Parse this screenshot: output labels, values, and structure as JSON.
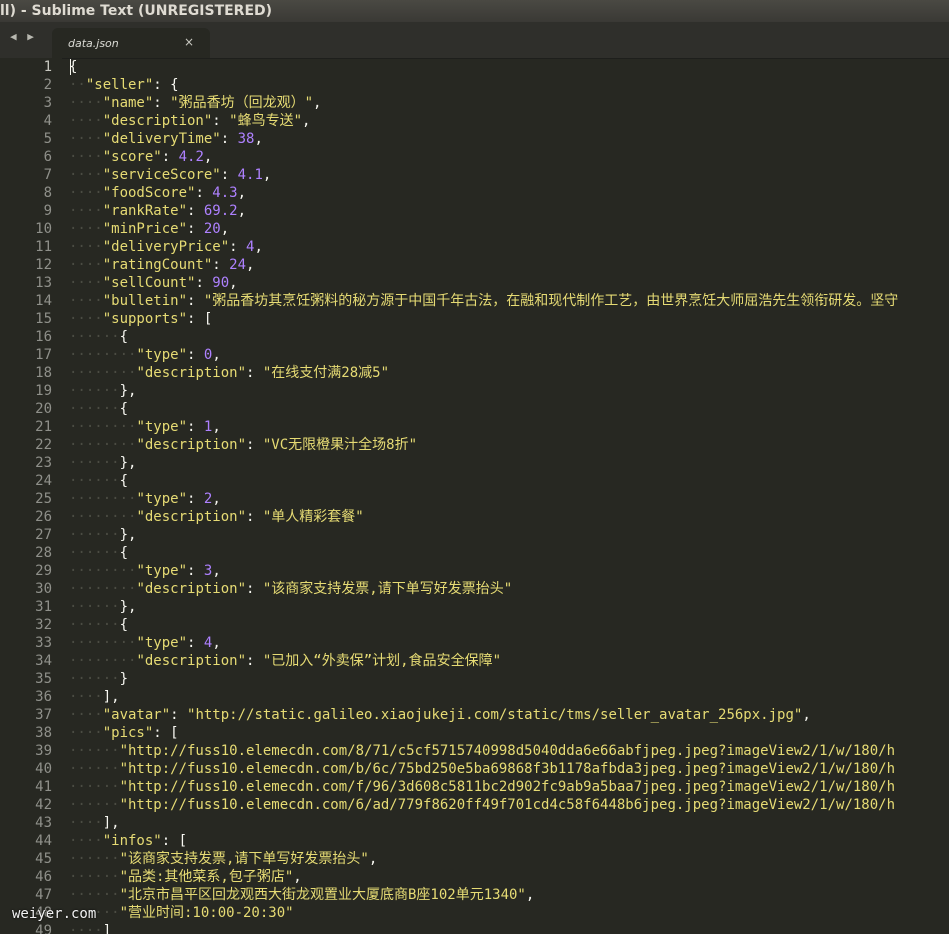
{
  "window": {
    "title": "ll) - Sublime Text (UNREGISTERED)"
  },
  "tabs": {
    "nav_label": "◀ ▶",
    "active": {
      "label": "data.json",
      "close_glyph": "×"
    }
  },
  "editor": {
    "current_line": 1,
    "lines": [
      [
        [
          "p",
          "{"
        ]
      ],
      [
        [
          "ws",
          "··"
        ],
        [
          "s",
          "\"seller\""
        ],
        [
          "p",
          ": {"
        ]
      ],
      [
        [
          "ws",
          "····"
        ],
        [
          "s",
          "\"name\""
        ],
        [
          "p",
          ": "
        ],
        [
          "s",
          "\"粥品香坊（回龙观）\""
        ],
        [
          "p",
          ","
        ]
      ],
      [
        [
          "ws",
          "····"
        ],
        [
          "s",
          "\"description\""
        ],
        [
          "p",
          ": "
        ],
        [
          "s",
          "\"蜂鸟专送\""
        ],
        [
          "p",
          ","
        ]
      ],
      [
        [
          "ws",
          "····"
        ],
        [
          "s",
          "\"deliveryTime\""
        ],
        [
          "p",
          ": "
        ],
        [
          "n",
          "38"
        ],
        [
          "p",
          ","
        ]
      ],
      [
        [
          "ws",
          "····"
        ],
        [
          "s",
          "\"score\""
        ],
        [
          "p",
          ": "
        ],
        [
          "n",
          "4.2"
        ],
        [
          "p",
          ","
        ]
      ],
      [
        [
          "ws",
          "····"
        ],
        [
          "s",
          "\"serviceScore\""
        ],
        [
          "p",
          ": "
        ],
        [
          "n",
          "4.1"
        ],
        [
          "p",
          ","
        ]
      ],
      [
        [
          "ws",
          "····"
        ],
        [
          "s",
          "\"foodScore\""
        ],
        [
          "p",
          ": "
        ],
        [
          "n",
          "4.3"
        ],
        [
          "p",
          ","
        ]
      ],
      [
        [
          "ws",
          "····"
        ],
        [
          "s",
          "\"rankRate\""
        ],
        [
          "p",
          ": "
        ],
        [
          "n",
          "69.2"
        ],
        [
          "p",
          ","
        ]
      ],
      [
        [
          "ws",
          "····"
        ],
        [
          "s",
          "\"minPrice\""
        ],
        [
          "p",
          ": "
        ],
        [
          "n",
          "20"
        ],
        [
          "p",
          ","
        ]
      ],
      [
        [
          "ws",
          "····"
        ],
        [
          "s",
          "\"deliveryPrice\""
        ],
        [
          "p",
          ": "
        ],
        [
          "n",
          "4"
        ],
        [
          "p",
          ","
        ]
      ],
      [
        [
          "ws",
          "····"
        ],
        [
          "s",
          "\"ratingCount\""
        ],
        [
          "p",
          ": "
        ],
        [
          "n",
          "24"
        ],
        [
          "p",
          ","
        ]
      ],
      [
        [
          "ws",
          "····"
        ],
        [
          "s",
          "\"sellCount\""
        ],
        [
          "p",
          ": "
        ],
        [
          "n",
          "90"
        ],
        [
          "p",
          ","
        ]
      ],
      [
        [
          "ws",
          "····"
        ],
        [
          "s",
          "\"bulletin\""
        ],
        [
          "p",
          ": "
        ],
        [
          "s",
          "\"粥品香坊其烹饪粥料的秘方源于中国千年古法，在融和现代制作工艺，由世界烹饪大师屈浩先生领衔研发。坚守"
        ]
      ],
      [
        [
          "ws",
          "····"
        ],
        [
          "s",
          "\"supports\""
        ],
        [
          "p",
          ": ["
        ]
      ],
      [
        [
          "ws",
          "······"
        ],
        [
          "p",
          "{"
        ]
      ],
      [
        [
          "ws",
          "········"
        ],
        [
          "s",
          "\"type\""
        ],
        [
          "p",
          ": "
        ],
        [
          "n",
          "0"
        ],
        [
          "p",
          ","
        ]
      ],
      [
        [
          "ws",
          "········"
        ],
        [
          "s",
          "\"description\""
        ],
        [
          "p",
          ": "
        ],
        [
          "s",
          "\"在线支付满28减5\""
        ]
      ],
      [
        [
          "ws",
          "······"
        ],
        [
          "p",
          "},"
        ]
      ],
      [
        [
          "ws",
          "······"
        ],
        [
          "p",
          "{"
        ]
      ],
      [
        [
          "ws",
          "········"
        ],
        [
          "s",
          "\"type\""
        ],
        [
          "p",
          ": "
        ],
        [
          "n",
          "1"
        ],
        [
          "p",
          ","
        ]
      ],
      [
        [
          "ws",
          "········"
        ],
        [
          "s",
          "\"description\""
        ],
        [
          "p",
          ": "
        ],
        [
          "s",
          "\"VC无限橙果汁全场8折\""
        ]
      ],
      [
        [
          "ws",
          "······"
        ],
        [
          "p",
          "},"
        ]
      ],
      [
        [
          "ws",
          "······"
        ],
        [
          "p",
          "{"
        ]
      ],
      [
        [
          "ws",
          "········"
        ],
        [
          "s",
          "\"type\""
        ],
        [
          "p",
          ": "
        ],
        [
          "n",
          "2"
        ],
        [
          "p",
          ","
        ]
      ],
      [
        [
          "ws",
          "········"
        ],
        [
          "s",
          "\"description\""
        ],
        [
          "p",
          ": "
        ],
        [
          "s",
          "\"单人精彩套餐\""
        ]
      ],
      [
        [
          "ws",
          "······"
        ],
        [
          "p",
          "},"
        ]
      ],
      [
        [
          "ws",
          "······"
        ],
        [
          "p",
          "{"
        ]
      ],
      [
        [
          "ws",
          "········"
        ],
        [
          "s",
          "\"type\""
        ],
        [
          "p",
          ": "
        ],
        [
          "n",
          "3"
        ],
        [
          "p",
          ","
        ]
      ],
      [
        [
          "ws",
          "········"
        ],
        [
          "s",
          "\"description\""
        ],
        [
          "p",
          ": "
        ],
        [
          "s",
          "\"该商家支持发票,请下单写好发票抬头\""
        ]
      ],
      [
        [
          "ws",
          "······"
        ],
        [
          "p",
          "},"
        ]
      ],
      [
        [
          "ws",
          "······"
        ],
        [
          "p",
          "{"
        ]
      ],
      [
        [
          "ws",
          "········"
        ],
        [
          "s",
          "\"type\""
        ],
        [
          "p",
          ": "
        ],
        [
          "n",
          "4"
        ],
        [
          "p",
          ","
        ]
      ],
      [
        [
          "ws",
          "········"
        ],
        [
          "s",
          "\"description\""
        ],
        [
          "p",
          ": "
        ],
        [
          "s",
          "\"已加入“外卖保”计划,食品安全保障\""
        ]
      ],
      [
        [
          "ws",
          "······"
        ],
        [
          "p",
          "}"
        ]
      ],
      [
        [
          "ws",
          "····"
        ],
        [
          "p",
          "],"
        ]
      ],
      [
        [
          "ws",
          "····"
        ],
        [
          "s",
          "\"avatar\""
        ],
        [
          "p",
          ": "
        ],
        [
          "s",
          "\"http://static.galileo.xiaojukeji.com/static/tms/seller_avatar_256px.jpg\""
        ],
        [
          "p",
          ","
        ]
      ],
      [
        [
          "ws",
          "····"
        ],
        [
          "s",
          "\"pics\""
        ],
        [
          "p",
          ": ["
        ]
      ],
      [
        [
          "ws",
          "······"
        ],
        [
          "s",
          "\"http://fuss10.elemecdn.com/8/71/c5cf5715740998d5040dda6e66abfjpeg.jpeg?imageView2/1/w/180/h"
        ]
      ],
      [
        [
          "ws",
          "······"
        ],
        [
          "s",
          "\"http://fuss10.elemecdn.com/b/6c/75bd250e5ba69868f3b1178afbda3jpeg.jpeg?imageView2/1/w/180/h"
        ]
      ],
      [
        [
          "ws",
          "······"
        ],
        [
          "s",
          "\"http://fuss10.elemecdn.com/f/96/3d608c5811bc2d902fc9ab9a5baa7jpeg.jpeg?imageView2/1/w/180/h"
        ]
      ],
      [
        [
          "ws",
          "······"
        ],
        [
          "s",
          "\"http://fuss10.elemecdn.com/6/ad/779f8620ff49f701cd4c58f6448b6jpeg.jpeg?imageView2/1/w/180/h"
        ]
      ],
      [
        [
          "ws",
          "····"
        ],
        [
          "p",
          "],"
        ]
      ],
      [
        [
          "ws",
          "····"
        ],
        [
          "s",
          "\"infos\""
        ],
        [
          "p",
          ": ["
        ]
      ],
      [
        [
          "ws",
          "······"
        ],
        [
          "s",
          "\"该商家支持发票,请下单写好发票抬头\""
        ],
        [
          "p",
          ","
        ]
      ],
      [
        [
          "ws",
          "······"
        ],
        [
          "s",
          "\"品类:其他菜系,包子粥店\""
        ],
        [
          "p",
          ","
        ]
      ],
      [
        [
          "ws",
          "······"
        ],
        [
          "s",
          "\"北京市昌平区回龙观西大街龙观置业大厦底商B座102单元1340\""
        ],
        [
          "p",
          ","
        ]
      ],
      [
        [
          "ws",
          "······"
        ],
        [
          "s",
          "\"营业时间:10:00-20:30\""
        ]
      ],
      [
        [
          "ws",
          "····"
        ],
        [
          "p",
          "]"
        ]
      ]
    ]
  },
  "watermark": "weiyer.com"
}
